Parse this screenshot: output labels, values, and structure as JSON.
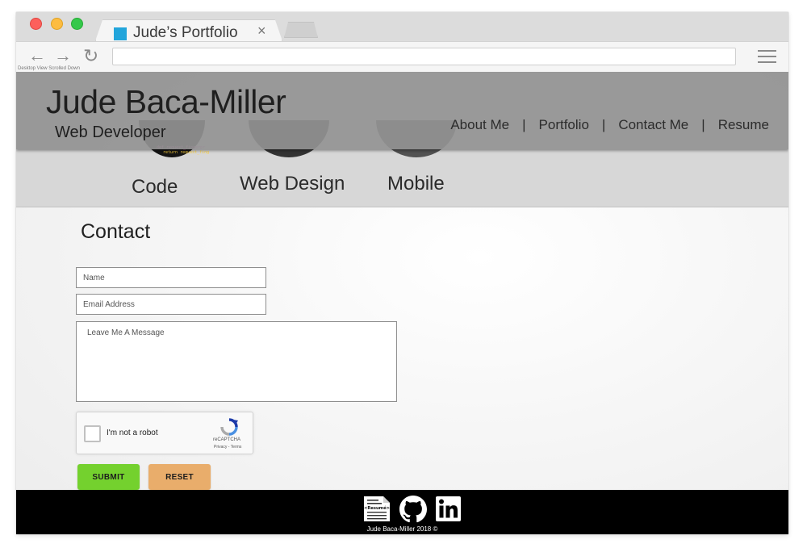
{
  "browser": {
    "tab_title": "Jude’s Portfolio",
    "tab_close": "×",
    "caption": "Desktop View Scrolled Down"
  },
  "header": {
    "name": "Jude Baca-Miller",
    "subtitle": "Web Developer",
    "nav": [
      "About Me",
      "Portfolio",
      "Contact Me",
      "Resume"
    ],
    "separator": "|"
  },
  "services": [
    {
      "label": "Code"
    },
    {
      "label": "Web Design"
    },
    {
      "label": "Mobile"
    }
  ],
  "contact": {
    "title": "Contact",
    "name_placeholder": "Name",
    "email_placeholder": "Email Address",
    "message_placeholder": "Leave Me A Message",
    "captcha_label": "I'm not a robot",
    "captcha_brand": "reCAPTCHA",
    "captcha_links": "Privacy - Terms",
    "submit_label": "SUBMIT",
    "reset_label": "RESET"
  },
  "footer": {
    "resume_icon_text": "<Resumé>",
    "copyright": "Jude Baca-Miller 2018 ©"
  },
  "colors": {
    "submit": "#74d12e",
    "reset": "#e9ad6b",
    "favicon": "#22a5db",
    "header_bg": "#919191",
    "footer_bg": "#000000"
  }
}
